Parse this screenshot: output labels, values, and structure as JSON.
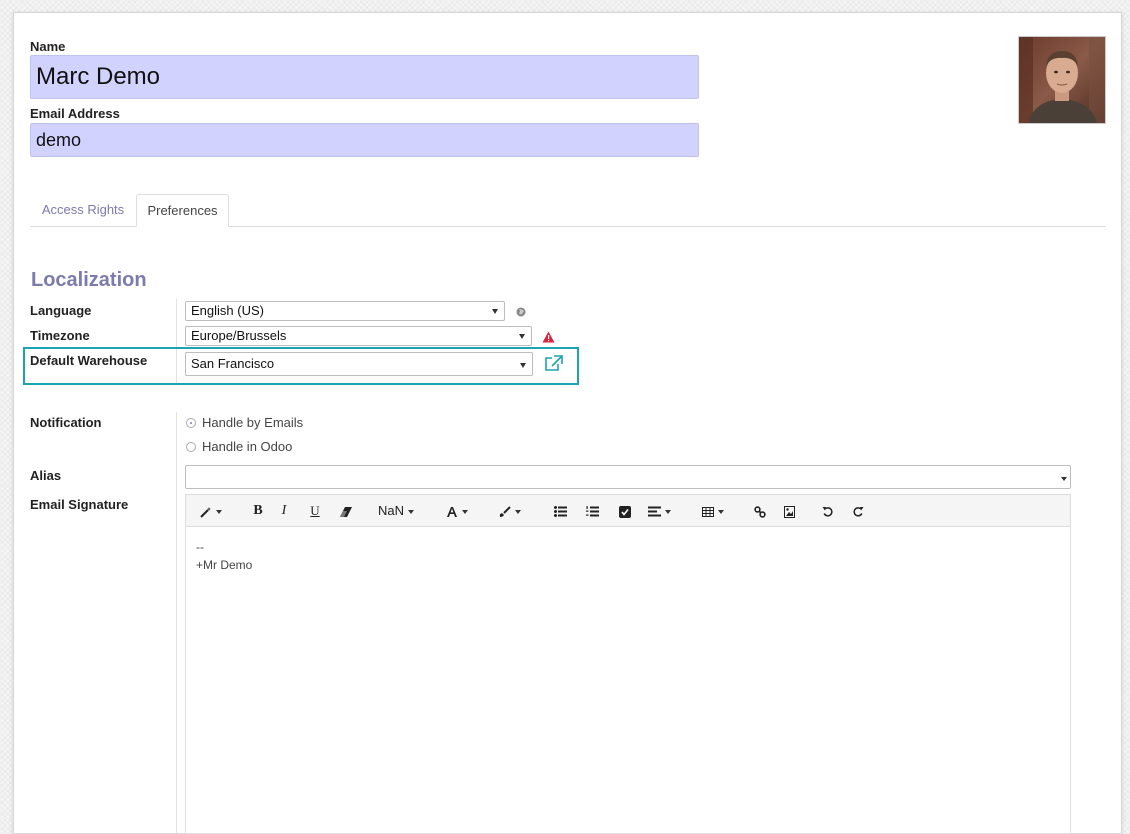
{
  "form": {
    "name_label": "Name",
    "name_value": "Marc Demo",
    "email_label": "Email Address",
    "email_value": "demo"
  },
  "tabs": [
    {
      "label": "Access Rights",
      "active": false
    },
    {
      "label": "Preferences",
      "active": true
    }
  ],
  "localization": {
    "title": "Localization",
    "language_label": "Language",
    "language_value": "English (US)",
    "timezone_label": "Timezone",
    "timezone_value": "Europe/Brussels",
    "warehouse_label": "Default Warehouse",
    "warehouse_value": "San Francisco"
  },
  "notification": {
    "label": "Notification",
    "options": [
      {
        "label": "Handle by Emails",
        "selected": true
      },
      {
        "label": "Handle in Odoo",
        "selected": false
      }
    ]
  },
  "alias": {
    "label": "Alias",
    "value": ""
  },
  "signature": {
    "label": "Email Signature",
    "toolbar": {
      "bold": "B",
      "italic": "I",
      "underline": "U",
      "font_size": "NaN"
    },
    "lines": [
      "--",
      "+Mr Demo"
    ]
  },
  "colors": {
    "accent": "#7c7bad",
    "input_required": "#d2d2ff",
    "highlight": "#1aa4b1",
    "warning": "#d9263f"
  },
  "icons": [
    "globe-icon",
    "warning-icon",
    "external-link-icon",
    "magic-wand-icon",
    "eraser-icon",
    "font-color-icon",
    "brush-icon",
    "bullet-list-icon",
    "numbered-list-icon",
    "checklist-icon",
    "align-icon",
    "table-icon",
    "link-icon",
    "image-icon",
    "undo-icon",
    "redo-icon"
  ]
}
